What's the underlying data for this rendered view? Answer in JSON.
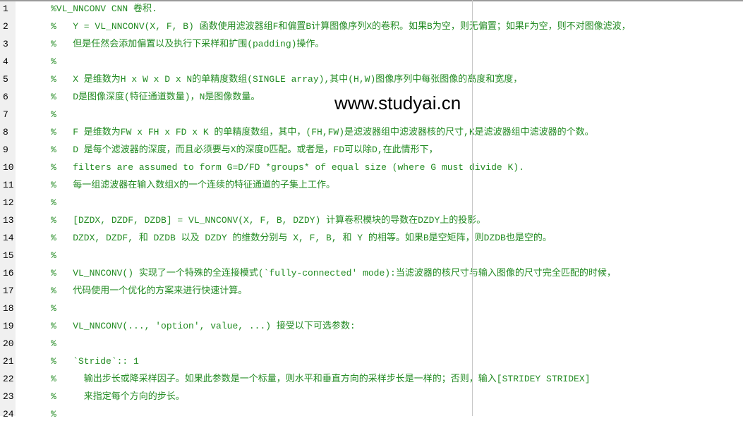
{
  "editor": {
    "lines": [
      "%VL_NNCONV CNN 卷积.",
      "%   Y = VL_NNCONV(X, F, B) 函数使用滤波器组F和偏置B计算图像序列X的卷积。如果B为空，则无偏置；如果F为空，则不对图像滤波，",
      "%   但是任然会添加偏置以及执行下采样和扩围(padding)操作。",
      "%",
      "%   X 是维数为H x W x D x N的单精度数组(SINGLE array),其中(H,W)图像序列中每张图像的高度和宽度，",
      "%   D是图像深度(特征通道数量)，N是图像数量。",
      "%",
      "%   F 是维数为FW x FH x FD x K 的单精度数组，其中，(FH,FW)是滤波器组中滤波器核的尺寸,K是滤波器组中滤波器的个数。",
      "%   D 是每个滤波器的深度，而且必须要与X的深度D匹配。或者是，FD可以除D,在此情形下，",
      "%   filters are assumed to form G=D/FD *groups* of equal size (where G must divide K).",
      "%   每一组滤波器在输入数组X的一个连续的特征通道的子集上工作。",
      "%",
      "%   [DZDX, DZDF, DZDB] = VL_NNCONV(X, F, B, DZDY) 计算卷积模块的导数在DZDY上的投影。",
      "%   DZDX, DZDF, 和 DZDB 以及 DZDY 的维数分别与 X, F, B, 和 Y 的相等。如果B是空矩阵，则DZDB也是空的。",
      "%",
      "%   VL_NNCONV() 实现了一个特殊的全连接模式(`fully-connected' mode):当滤波器的核尺寸与输入图像的尺寸完全匹配的时候，",
      "%   代码使用一个优化的方案来进行快速计算。",
      "%",
      "%   VL_NNCONV(..., 'option', value, ...) 接受以下可选参数:",
      "%",
      "%   `Stride`:: 1",
      "%     输出步长或降采样因子。如果此参数是一个标量，则水平和垂直方向的采样步长是一样的；否则，输入[STRIDEY STRIDEX]",
      "%     来指定每个方向的步长。",
      "%"
    ],
    "line_numbers": [
      "1",
      "2",
      "3",
      "4",
      "5",
      "6",
      "7",
      "8",
      "9",
      "10",
      "11",
      "12",
      "13",
      "14",
      "15",
      "16",
      "17",
      "18",
      "19",
      "20",
      "21",
      "22",
      "23",
      "24"
    ]
  },
  "watermark": "www.studyai.cn",
  "colors": {
    "comment": "#228b22",
    "gutter": "#f0f0f0"
  }
}
